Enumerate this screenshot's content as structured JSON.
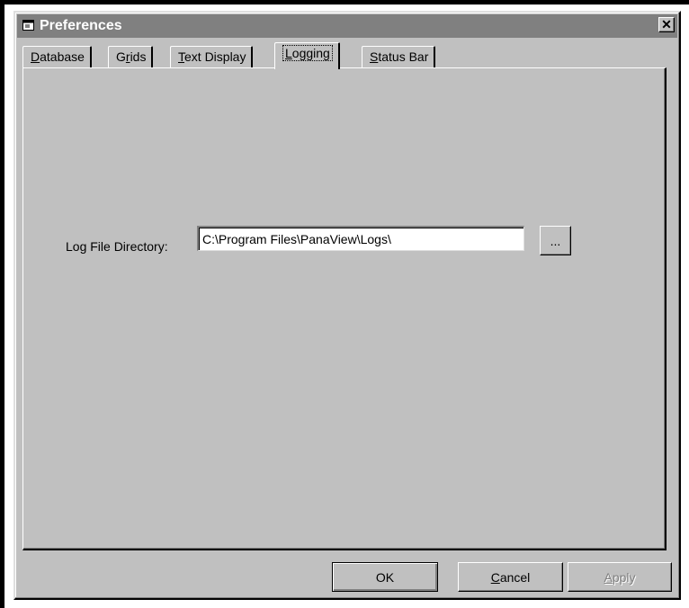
{
  "window": {
    "title": "Preferences",
    "close_glyph": "✕"
  },
  "tabs": [
    {
      "key": "D",
      "rest": "atabase"
    },
    {
      "pre": "G",
      "key": "r",
      "rest": "ids"
    },
    {
      "key": "T",
      "rest": "ext Display"
    },
    {
      "key": "L",
      "rest": "ogging",
      "active": true
    },
    {
      "key": "S",
      "rest": "tatus Bar"
    }
  ],
  "logging": {
    "log_dir_label": "Log File Directory:",
    "log_dir_value": "C:\\Program Files\\PanaView\\Logs\\",
    "browse_label": "..."
  },
  "buttons": {
    "ok": "OK",
    "cancel_key": "C",
    "cancel_rest": "ancel",
    "apply_key": "A",
    "apply_rest": "pply"
  },
  "colors": {
    "face": "#c0c0c0",
    "titlebar_inactive": "#808080"
  },
  "icons": {
    "title": "window-icon",
    "close": "close-icon"
  }
}
